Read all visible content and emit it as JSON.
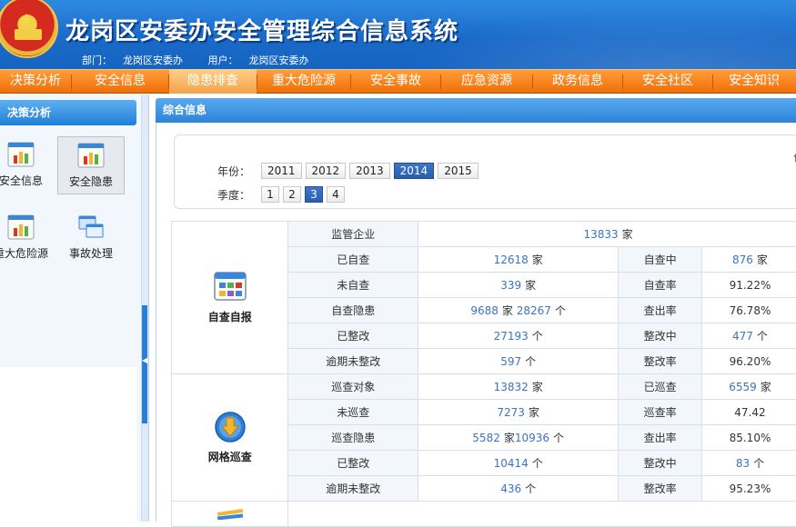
{
  "header": {
    "title": "龙岗区安委办安全管理综合信息系统",
    "dept_label": "部门：",
    "dept": "龙岗区安委办",
    "user_label": "用户：",
    "user": "龙岗区安委办"
  },
  "nav": {
    "items": [
      {
        "label": "决策分析"
      },
      {
        "label": "安全信息"
      },
      {
        "label": "隐患排查"
      },
      {
        "label": "重大危险源"
      },
      {
        "label": "安全事故"
      },
      {
        "label": "应急资源"
      },
      {
        "label": "政务信息"
      },
      {
        "label": "安全社区"
      },
      {
        "label": "安全知识"
      }
    ],
    "active_index": 2
  },
  "left_panel": {
    "title": "决策分析",
    "items": [
      {
        "label": "安全信息",
        "icon": "bar-chart-icon"
      },
      {
        "label": "安全隐患",
        "icon": "bar-chart-icon",
        "selected": true
      },
      {
        "label": "重大危险源",
        "icon": "bar-chart-icon"
      },
      {
        "label": "事故处理",
        "icon": "windows-icon"
      }
    ]
  },
  "main": {
    "tab_title": "综合信息",
    "filter": {
      "year_label": "年份：",
      "years": [
        "2011",
        "2012",
        "2013",
        "2014",
        "2015"
      ],
      "selected_year": "2014",
      "quarter_label": "季度：",
      "quarters": [
        "1",
        "2",
        "3",
        "4"
      ],
      "selected_quarter": "3",
      "cut_text": "包"
    },
    "table": {
      "self_check": {
        "group": "自查自报",
        "supervised_label": "监管企业",
        "supervised_value": "13833",
        "supervised_unit": "家",
        "rows": [
          {
            "label": "已自查",
            "value": "12618",
            "unit": "家",
            "label2": "自查中",
            "value2": "876",
            "unit2": "家"
          },
          {
            "label": "未自查",
            "value": "339",
            "unit": "家",
            "label2": "自查率",
            "value2": "91.22%",
            "unit2": ""
          },
          {
            "label": "自查隐患",
            "value": "9688",
            "unit": "家",
            "extra_value": "28267",
            "extra_unit": "个",
            "label2": "查出率",
            "value2": "76.78%",
            "unit2": ""
          },
          {
            "label": "已整改",
            "value": "27193",
            "unit": "个",
            "label2": "整改中",
            "value2": "477",
            "unit2": "个"
          },
          {
            "label": "逾期未整改",
            "value": "597",
            "unit": "个",
            "label2": "整改率",
            "value2": "96.20%",
            "unit2": ""
          }
        ]
      },
      "grid_patrol": {
        "group": "网格巡查",
        "rows": [
          {
            "label": "巡查对象",
            "value": "13832",
            "unit": "家",
            "label2": "已巡查",
            "value2": "6559",
            "unit2": "家"
          },
          {
            "label": "未巡查",
            "value": "7273",
            "unit": "家",
            "label2": "巡查率",
            "value2": "47.42",
            "unit2": ""
          },
          {
            "label": "巡查隐患",
            "value": "5582",
            "unit": "家",
            "extra_value": "10936",
            "extra_unit": "个",
            "label2": "查出率",
            "value2": "85.10%",
            "unit2": ""
          },
          {
            "label": "已整改",
            "value": "10414",
            "unit": "个",
            "label2": "整改中",
            "value2": "83",
            "unit2": "个"
          },
          {
            "label": "逾期未整改",
            "value": "436",
            "unit": "个",
            "label2": "整改率",
            "value2": "95.23%",
            "unit2": ""
          }
        ]
      }
    }
  },
  "colors": {
    "header_blue": "#1a6ac9",
    "nav_orange": "#ef6f08",
    "link_blue": "#3a73c6",
    "selected_button": "#2a5fae"
  }
}
